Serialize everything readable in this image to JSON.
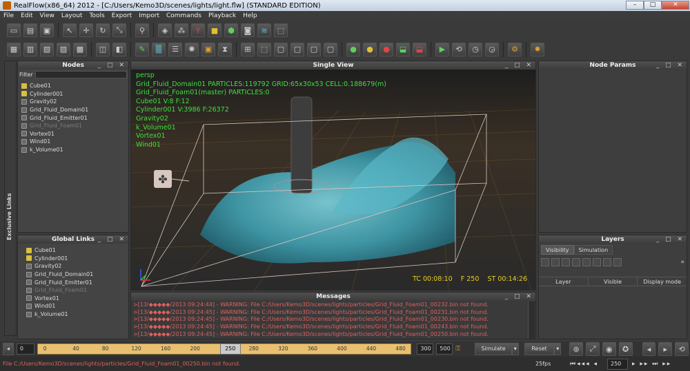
{
  "window": {
    "title": "RealFlow(x86_64) 2012 - [C:/Users/Kemo3D/scenes/lights/light.flw] (STANDARD EDITION)",
    "min": "–",
    "max": "□",
    "close": "✕"
  },
  "menu": [
    "File",
    "Edit",
    "View",
    "Layout",
    "Tools",
    "Export",
    "Import",
    "Commands",
    "Playback",
    "Help"
  ],
  "nodes_panel": {
    "title": "Nodes",
    "controls": "_ □ ✕",
    "filter_label": "Filter",
    "filter_value": "",
    "items": [
      {
        "label": "Cube01",
        "icon": "cube-icon"
      },
      {
        "label": "Cylinder001",
        "icon": "cube-icon"
      },
      {
        "label": "Gravity02",
        "icon": "wire-icon"
      },
      {
        "label": "Grid_Fluid_Domain01",
        "icon": "wire-icon"
      },
      {
        "label": "Grid_Fluid_Emitter01",
        "icon": "wire-icon"
      },
      {
        "label": "Grid_Fluid_Foam01",
        "icon": "wire-icon",
        "dim": true
      },
      {
        "label": "Vortex01",
        "icon": "wire-icon"
      },
      {
        "label": "Wind01",
        "icon": "wire-icon"
      },
      {
        "label": "k_Volume01",
        "icon": "wire-icon"
      }
    ]
  },
  "exclusive_links": {
    "label": "Exclusive Links"
  },
  "global_links": {
    "title": "Global Links",
    "controls": "_ □ ✕",
    "items": [
      {
        "label": "Cube01",
        "icon": "cube-icon"
      },
      {
        "label": "Cylinder001",
        "icon": "cube-icon"
      },
      {
        "label": "Gravity02",
        "icon": "wire-icon"
      },
      {
        "label": "Grid_Fluid_Domain01",
        "icon": "wire-icon"
      },
      {
        "label": "Grid_Fluid_Emitter01",
        "icon": "wire-icon"
      },
      {
        "label": "Grid_Fluid_Foam01",
        "icon": "wire-icon",
        "dim": true
      },
      {
        "label": "Vortex01",
        "icon": "wire-icon"
      },
      {
        "label": "Wind01",
        "icon": "wire-icon"
      },
      {
        "label": "k_Volume01",
        "icon": "wire-icon"
      }
    ]
  },
  "viewport": {
    "title": "Single View",
    "controls": "_ □ ✕",
    "overlay": [
      "persp",
      "Grid_Fluid_Domain01 PARTICLES:119792 GRID:65x30x53 CELL:0.188679(m)",
      "Grid_Fluid_Foam01(master) PARTICLES:0",
      "Cube01 V:8 F:12",
      "Cylinder001 V:3986 F:26372",
      "Gravity02",
      "k_Volume01",
      "Vortex01",
      "Wind01"
    ],
    "tc": "TC 00:08:10",
    "frame": "F 250",
    "st": "ST 00:14:26"
  },
  "node_params": {
    "title": "Node Params",
    "controls": "_ □ ✕"
  },
  "layers": {
    "title": "Layers",
    "controls": "_ □ ✕",
    "tabs": [
      "Visibility",
      "Simulation"
    ],
    "columns": [
      "Layer",
      "Visible",
      "Display mode"
    ]
  },
  "messages": {
    "title": "Messages",
    "controls": "_ □ ✕",
    "rows": [
      ">[13/◆◆◆◆◆/2013 09:24:44] - WARNING: File C:/Users/Kemo3D/scenes/lights/particles/Grid_Fluid_Foam01_00232.bin not found.",
      ">[13/◆◆◆◆◆/2013 09:24:45] - WARNING: File C:/Users/Kemo3D/scenes/lights/particles/Grid_Fluid_Foam01_00231.bin not found.",
      ">[13/◆◆◆◆◆/2013 09:24:45] - WARNING: File C:/Users/Kemo3D/scenes/lights/particles/Grid_Fluid_Foam01_00230.bin not found.",
      ">[13/◆◆◆◆◆/2013 09:24:45] - WARNING: File C:/Users/Kemo3D/scenes/lights/particles/Grid_Fluid_Foam01_00243.bin not found.",
      ">[13/◆◆◆◆◆/2013 09:24:45] - WARNING: File C:/Users/Kemo3D/scenes/lights/particles/Grid_Fluid_Foam01_00250.bin not found."
    ]
  },
  "timeline": {
    "start": "0",
    "end_a": "300",
    "end_b": "500",
    "current": "250",
    "ticks": [
      "0",
      "40",
      "80",
      "120",
      "160",
      "200",
      "250",
      "280",
      "320",
      "360",
      "400",
      "440",
      "480"
    ],
    "simulate": "Simulate",
    "reset": "Reset"
  },
  "status": {
    "text": "File C:/Users/Kemo3D/scenes/lights/particles/Grid_Fluid_Foam01_00250.bin not found.",
    "fps": "25fps",
    "frame": "250"
  }
}
